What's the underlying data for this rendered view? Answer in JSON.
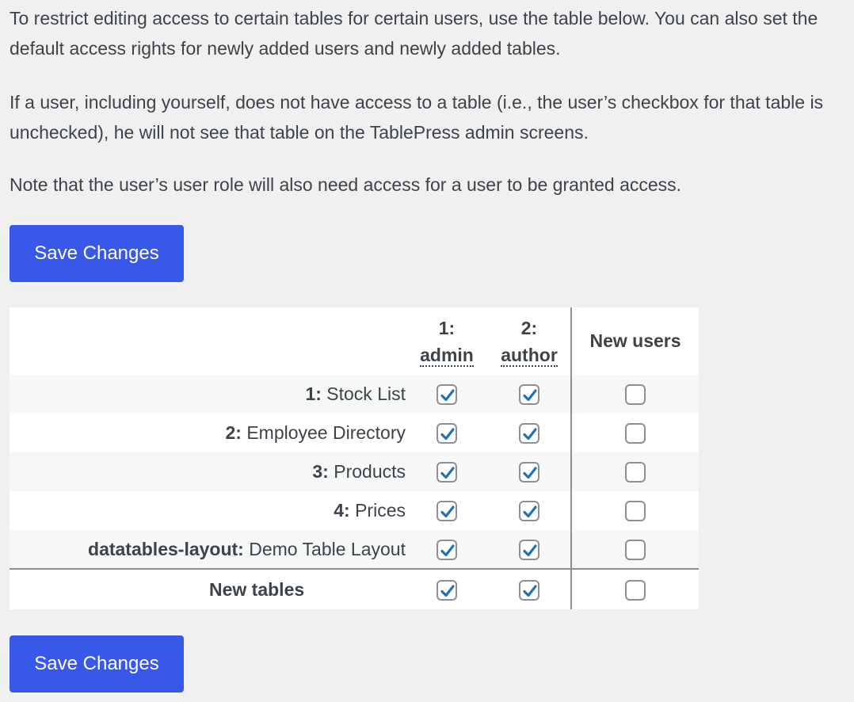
{
  "intro": {
    "paragraph1": "To restrict editing access to certain tables for certain users, use the table below. You can also set the default access rights for newly added users and newly added tables.",
    "paragraph2": "If a user, including yourself, does not have access to a table (i.e., the user’s checkbox for that table is unchecked), he will not see that table on the TablePress admin screens.",
    "paragraph3": "Note that the user’s user role will also need access for a user to be granted access."
  },
  "buttons": {
    "save_top": "Save Changes",
    "save_bottom": "Save Changes"
  },
  "table": {
    "users": [
      {
        "id": "1:",
        "name": "admin"
      },
      {
        "id": "2:",
        "name": "author"
      }
    ],
    "new_users_label": "New users",
    "rows": [
      {
        "id": "1:",
        "name": "Stock List",
        "admin": true,
        "author": true,
        "new_users": false
      },
      {
        "id": "2:",
        "name": "Employee Directory",
        "admin": true,
        "author": true,
        "new_users": false
      },
      {
        "id": "3:",
        "name": "Products",
        "admin": true,
        "author": true,
        "new_users": false
      },
      {
        "id": "4:",
        "name": "Prices",
        "admin": true,
        "author": true,
        "new_users": false
      },
      {
        "id": "datatables-layout:",
        "name": "Demo Table Layout",
        "admin": true,
        "author": true,
        "new_users": false
      }
    ],
    "new_tables": {
      "label": "New tables",
      "admin": true,
      "author": true,
      "new_users": false
    }
  },
  "colors": {
    "accent": "#3858e9",
    "check": "#2271b1",
    "background": "#f0f0f1"
  }
}
